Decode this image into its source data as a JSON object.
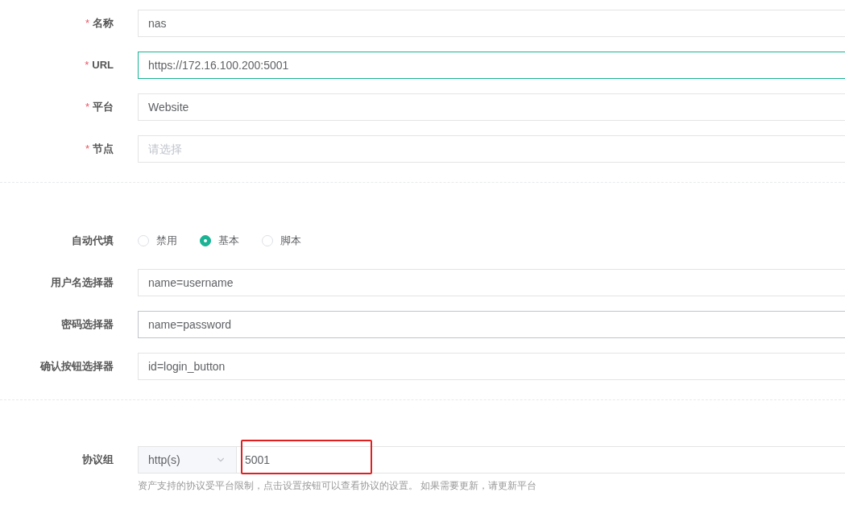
{
  "basic_fields": [
    {
      "mark": "*",
      "label": "名称",
      "value": "nas",
      "focused": false,
      "hovered": false
    },
    {
      "mark": "*",
      "label": "URL",
      "value": "https://172.16.100.200:5001",
      "focused": true,
      "hovered": false
    },
    {
      "mark": "*",
      "label": "平台",
      "value": "Website",
      "focused": false,
      "hovered": false
    },
    {
      "mark": "*",
      "label": "节点",
      "placeholder": "请选择",
      "focused": false,
      "hovered": false
    }
  ],
  "autofill": {
    "label": "自动代填",
    "options": [
      {
        "label": "禁用",
        "selected": false
      },
      {
        "label": "基本",
        "selected": true
      },
      {
        "label": "脚本",
        "selected": false
      }
    ]
  },
  "selector_fields": [
    {
      "label": "用户名选择器",
      "value": "name=username",
      "focused": false,
      "hovered": false
    },
    {
      "label": "密码选择器",
      "value": "name=password",
      "focused": false,
      "hovered": true
    },
    {
      "label": "确认按钮选择器",
      "value": "id=login_button",
      "focused": false,
      "hovered": false
    }
  ],
  "protocols": {
    "label": "协议组",
    "protocol": "http(s)",
    "port": "5001",
    "highlighted": true,
    "hint": "资产支持的协议受平台限制，点击设置按钮可以查看协议的设置。 如果需要更新，请更新平台"
  }
}
